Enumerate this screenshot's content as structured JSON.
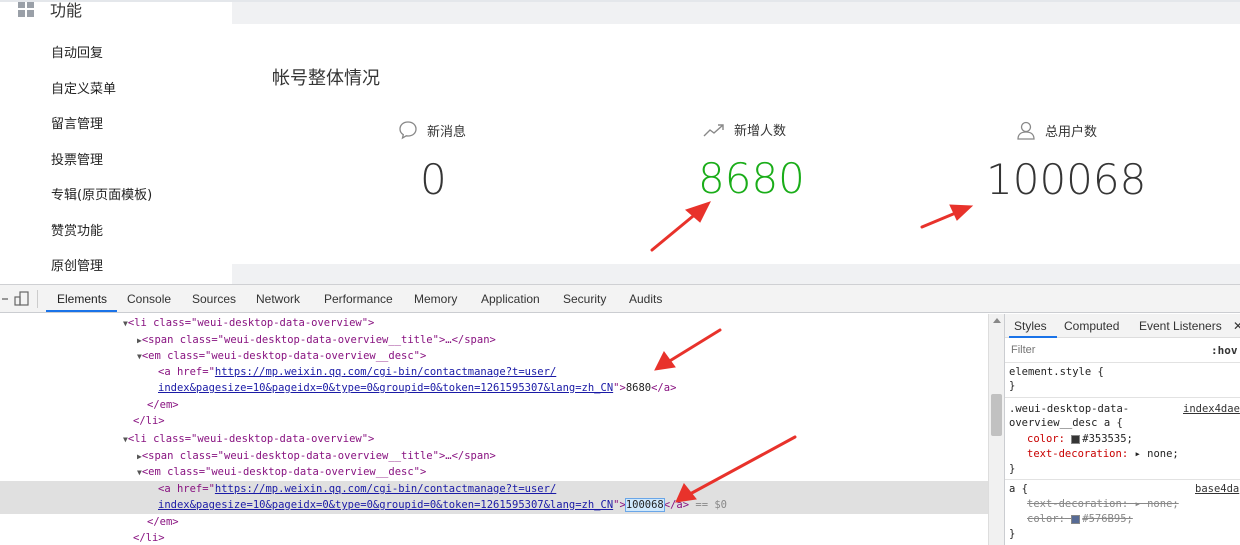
{
  "sidebar": {
    "section_title": "功能",
    "items": [
      {
        "label": "自动回复"
      },
      {
        "label": "自定义菜单"
      },
      {
        "label": "留言管理"
      },
      {
        "label": "投票管理"
      },
      {
        "label": "专辑(原页面模板)"
      },
      {
        "label": "赞赏功能"
      },
      {
        "label": "原创管理"
      }
    ]
  },
  "overview": {
    "title": "帐号整体情况",
    "stats": [
      {
        "label": "新消息",
        "value": "0",
        "icon": "chat-bubble-icon"
      },
      {
        "label": "新增人数",
        "value": "8680",
        "icon": "trend-up-icon",
        "color": "#1aad19"
      },
      {
        "label": "总用户数",
        "value": "100068",
        "icon": "user-icon"
      }
    ]
  },
  "devtools": {
    "tabs": [
      "Elements",
      "Console",
      "Sources",
      "Network",
      "Performance",
      "Memory",
      "Application",
      "Security",
      "Audits"
    ],
    "active_tab": "Elements",
    "dom": {
      "li_open": "<li class=\"weui-desktop-data-overview\">",
      "span_line": "<span class=\"weui-desktop-data-overview__title\">…</span>",
      "em_open": "<em class=\"weui-desktop-data-overview__desc\">",
      "a_prefix": "<a href=\"",
      "href_1": "https://mp.weixin.qq.com/cgi-bin/contactmanage?t=user/",
      "href_2": "index&pagesize=10&pageidx=0&type=0&groupid=0&token=1261595307&lang=zh_CN",
      "a_close": "</a>",
      "em_close": "</em>",
      "li_close": "</li>",
      "value_1": "8680",
      "value_2": "100068",
      "eq_ref": "== $0"
    },
    "styles": {
      "tabs": [
        "Styles",
        "Computed",
        "Event Listeners"
      ],
      "filter_placeholder": "Filter",
      "hov": ":hov",
      "element_style": "element.style {",
      "close_brace": "}",
      "rule1_selector_1": ".weui-desktop-data-",
      "rule1_selector_2": "overview__desc a {",
      "rule1_source": "index4dae",
      "rule1_color_prop": "color:",
      "rule1_color_val": "#353535;",
      "rule1_td_prop": "text-decoration:",
      "rule1_td_val": "none;",
      "rule2_selector": "a {",
      "rule2_source": "base4da",
      "rule2_td": "text-decoration: ▸ none;",
      "rule2_color": "color:",
      "rule2_color_val": "#576B95;",
      "color_dark": "#353535",
      "color_link": "#576B95"
    }
  },
  "colors": {
    "accent_green": "#1aad19",
    "annotation_red": "#e8322b",
    "devtools_blue": "#1a73e8"
  }
}
